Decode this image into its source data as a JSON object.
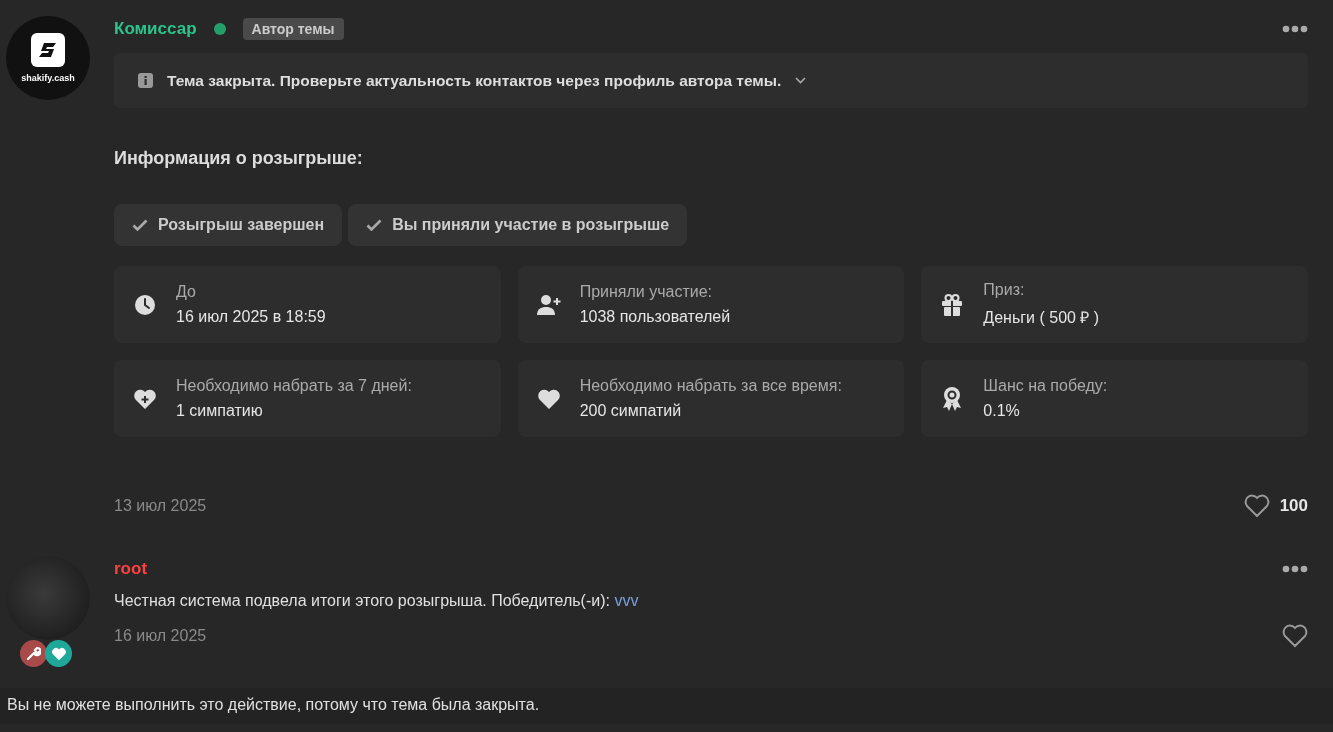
{
  "posts": [
    {
      "author": "Комиссар",
      "color": "#2bc48a",
      "online": true,
      "badge": "Автор темы",
      "avatar": {
        "kind": "logo",
        "label": "shakify.cash"
      },
      "notice": {
        "text": "Тема закрыта. Проверьте актуальность контактов через профиль автора темы."
      },
      "giveaway": {
        "title": "Информация о розыгрыше:",
        "statuses": [
          "Розыгрыш завершен",
          "Вы приняли участие в розыгрыше"
        ],
        "info": [
          {
            "kind": "clock",
            "label": "До",
            "value": "16 июл 2025 в 18:59"
          },
          {
            "kind": "user-plus",
            "label": "Приняли участие:",
            "value": "1038 пользователей"
          },
          {
            "kind": "gift",
            "label": "Приз:",
            "value": "Деньги ( 500 ₽ )"
          },
          {
            "kind": "heart-plus",
            "label": "Необходимо набрать за 7 дней:",
            "value": "1 симпатию"
          },
          {
            "kind": "heart",
            "label": "Необходимо набрать за все время:",
            "value": "200 симпатий"
          },
          {
            "kind": "award",
            "label": "Шанс на победу:",
            "value": "0.1%"
          }
        ]
      },
      "date": "13 июл 2025",
      "likes": "100"
    },
    {
      "author": "root",
      "color": "#ff4040",
      "avatar": {
        "kind": "photo"
      },
      "role_icons": [
        {
          "kind": "wrench",
          "color": "#a94a4a"
        },
        {
          "kind": "heart",
          "color": "#1fa89a"
        }
      ],
      "text": "Честная система подвела итоги этого розыгрыша. Победитель(-и): ",
      "link": "vvv",
      "date": "16 июл 2025"
    }
  ],
  "footer_note": "Вы не можете выполнить это действие, потому что тема была закрыта."
}
